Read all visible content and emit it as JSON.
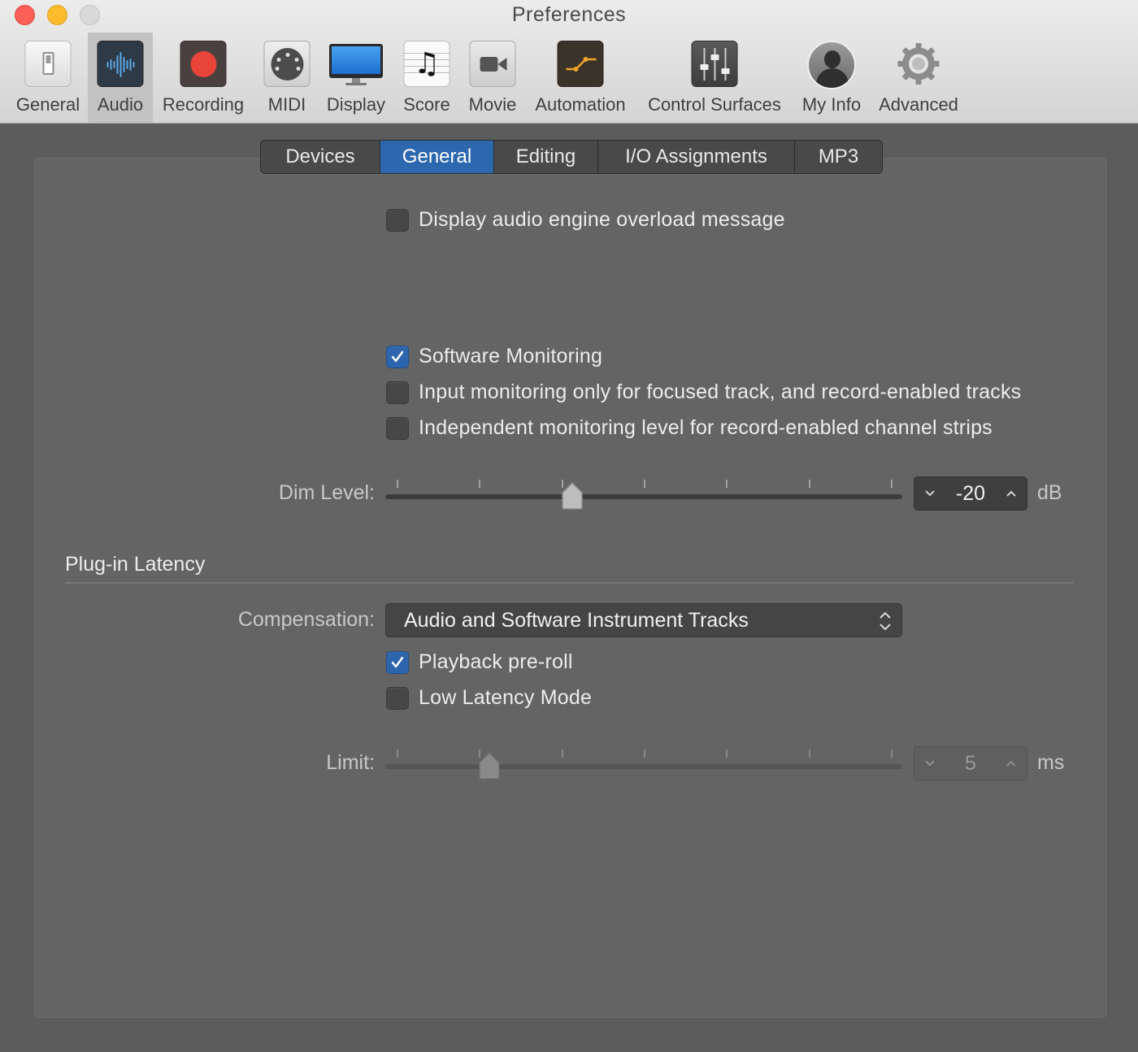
{
  "window": {
    "title": "Preferences"
  },
  "toolbar": {
    "items": [
      {
        "label": "General",
        "icon": "general-icon",
        "selected": false
      },
      {
        "label": "Audio",
        "icon": "audio-waveform-icon",
        "selected": true
      },
      {
        "label": "Recording",
        "icon": "record-icon",
        "selected": false
      },
      {
        "label": "MIDI",
        "icon": "midi-connector-icon",
        "selected": false
      },
      {
        "label": "Display",
        "icon": "display-monitor-icon",
        "selected": false
      },
      {
        "label": "Score",
        "icon": "music-note-icon",
        "selected": false
      },
      {
        "label": "Movie",
        "icon": "video-camera-icon",
        "selected": false
      },
      {
        "label": "Automation",
        "icon": "automation-curve-icon",
        "selected": false
      },
      {
        "label": "Control Surfaces",
        "icon": "faders-icon",
        "selected": false
      },
      {
        "label": "My Info",
        "icon": "user-silhouette-icon",
        "selected": false
      },
      {
        "label": "Advanced",
        "icon": "gear-icon",
        "selected": false
      }
    ]
  },
  "tabs": [
    {
      "label": "Devices",
      "active": false
    },
    {
      "label": "General",
      "active": true
    },
    {
      "label": "Editing",
      "active": false
    },
    {
      "label": "I/O Assignments",
      "active": false
    },
    {
      "label": "MP3",
      "active": false
    }
  ],
  "options": {
    "overload_message": {
      "label": "Display audio engine overload message",
      "checked": false
    },
    "software_monitoring": {
      "label": "Software Monitoring",
      "checked": true
    },
    "input_monitoring_focused": {
      "label": "Input monitoring only for focused track, and record-enabled tracks",
      "checked": false
    },
    "independent_monitoring": {
      "label": "Independent monitoring level for record-enabled channel strips",
      "checked": false
    }
  },
  "dim_level": {
    "label": "Dim Level:",
    "value": "-20",
    "unit": "dB",
    "slider_fraction": 0.34
  },
  "plugin_latency": {
    "section_title": "Plug-in Latency",
    "compensation_label": "Compensation:",
    "compensation_value": "Audio and Software Instrument Tracks",
    "playback_preroll": {
      "label": "Playback pre-roll",
      "checked": true
    },
    "low_latency_mode": {
      "label": "Low Latency Mode",
      "checked": false
    },
    "limit": {
      "label": "Limit:",
      "value": "5",
      "unit": "ms",
      "slider_fraction": 0.18,
      "enabled": false
    }
  },
  "colors": {
    "accent": "#2d68ae",
    "panel": "#646464",
    "background": "#5c5c5c",
    "record_red": "#e8443a"
  }
}
